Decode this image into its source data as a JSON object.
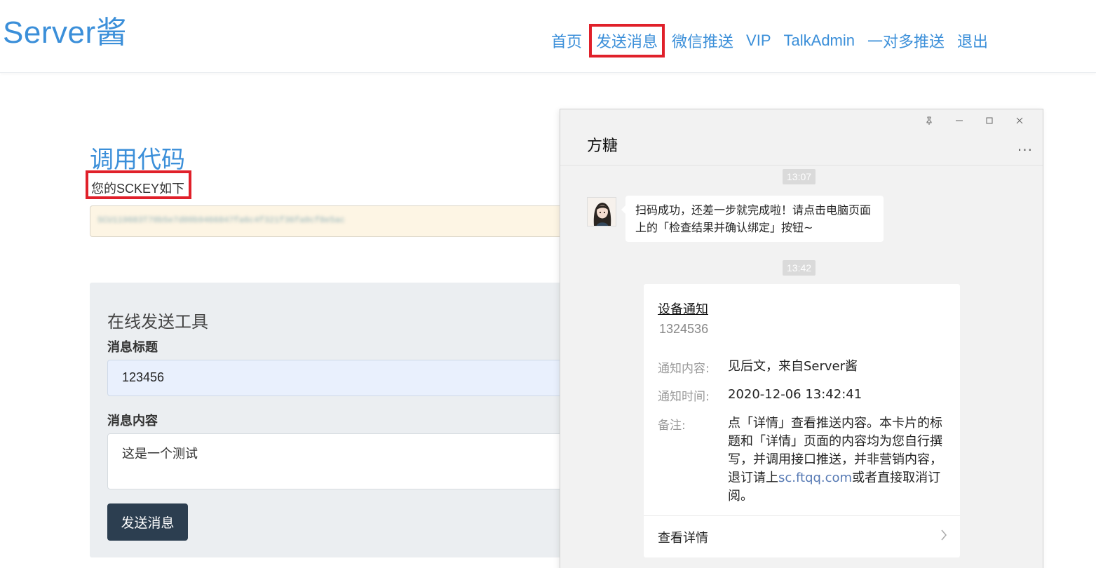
{
  "header": {
    "brand": "Server酱",
    "nav": [
      "首页",
      "发送消息",
      "微信推送",
      "VIP",
      "TalkAdmin",
      "一对多推送",
      "退出"
    ]
  },
  "main": {
    "section_title": "调用代码",
    "sckey_label": "您的SCKEY如下",
    "sckey_value": "SCU119683T70b5e7d00b9466847fa6c4f321f36fa0cf8e5ac",
    "tool": {
      "title": "在线发送工具",
      "title_label": "消息标题",
      "title_value": "123456",
      "content_label": "消息内容",
      "content_value": "这是一个测试",
      "send_label": "发送消息"
    }
  },
  "chat": {
    "title": "方糖",
    "more": "...",
    "window_controls": [
      "pin-icon",
      "minimize-icon",
      "maximize-icon",
      "close-icon"
    ],
    "time1": "13:07",
    "message": "扫码成功，还差一步就完成啦！请点击电脑页面上的「检查结果并确认绑定」按钮~",
    "time2": "13:42",
    "card": {
      "title": "设备通知",
      "sub": "1324536",
      "content_key": "通知内容:",
      "content_val": "见后文，来自Server酱",
      "time_key": "通知时间:",
      "time_val": "2020-12-06 13:42:41",
      "note_key": "备注:",
      "note_val_pre": "点「详情」查看推送内容。本卡片的标题和「详情」页面的内容均为您自行撰写，并调用接口推送，并非营销内容，退订请上",
      "note_link": "sc.ftqq.com",
      "note_val_post": "或者直接取消订阅。",
      "footer": "查看详情"
    }
  },
  "colors": {
    "accent": "#3b8fd9",
    "highlight": "#e0202a",
    "button": "#2c3e50"
  }
}
